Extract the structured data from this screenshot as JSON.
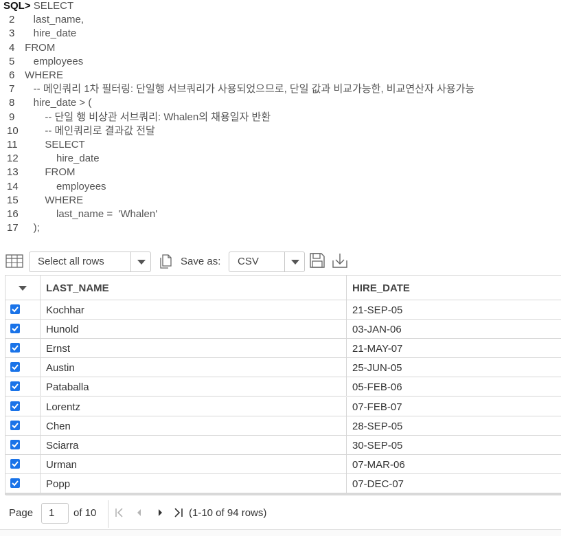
{
  "editor": {
    "prompt": "SQL>",
    "lines": [
      {
        "num": "",
        "text": " SELECT"
      },
      {
        "num": "2",
        "text": "    last_name,"
      },
      {
        "num": "3",
        "text": "    hire_date"
      },
      {
        "num": "4",
        "text": " FROM"
      },
      {
        "num": "5",
        "text": "    employees"
      },
      {
        "num": "6",
        "text": " WHERE"
      },
      {
        "num": "7",
        "text": "    -- 메인쿼리 1차 필터링: 단일행 서브쿼리가 사용되었으므로, 단일 값과 비교가능한, 비교연산자 사용가능"
      },
      {
        "num": "8",
        "text": "    hire_date > ("
      },
      {
        "num": "9",
        "text": "        -- 단일 행 비상관 서브쿼리: Whalen의 채용일자 반환"
      },
      {
        "num": "10",
        "text": "        -- 메인쿼리로 결과값 전달"
      },
      {
        "num": "11",
        "text": "        SELECT"
      },
      {
        "num": "12",
        "text": "            hire_date"
      },
      {
        "num": "13",
        "text": "        FROM"
      },
      {
        "num": "14",
        "text": "            employees"
      },
      {
        "num": "15",
        "text": "        WHERE"
      },
      {
        "num": "16",
        "text": "            last_name =  'Whalen'"
      },
      {
        "num": "17",
        "text": "    );"
      }
    ]
  },
  "toolbar": {
    "grid_icon": "table-grid-icon",
    "row_select": "Select all rows",
    "copy_icon": "copy-icon",
    "save_as_label": "Save as:",
    "format_select": "CSV",
    "save_icon": "floppy-disk-icon",
    "download_icon": "download-icon"
  },
  "grid": {
    "columns": [
      "LAST_NAME",
      "HIRE_DATE"
    ],
    "rows": [
      {
        "last_name": "Kochhar",
        "hire_date": "21-SEP-05",
        "checked": true
      },
      {
        "last_name": "Hunold",
        "hire_date": "03-JAN-06",
        "checked": true
      },
      {
        "last_name": "Ernst",
        "hire_date": "21-MAY-07",
        "checked": true
      },
      {
        "last_name": "Austin",
        "hire_date": "25-JUN-05",
        "checked": true
      },
      {
        "last_name": "Pataballa",
        "hire_date": "05-FEB-06",
        "checked": true
      },
      {
        "last_name": "Lorentz",
        "hire_date": "07-FEB-07",
        "checked": true
      },
      {
        "last_name": "Chen",
        "hire_date": "28-SEP-05",
        "checked": true
      },
      {
        "last_name": "Sciarra",
        "hire_date": "30-SEP-05",
        "checked": true
      },
      {
        "last_name": "Urman",
        "hire_date": "07-MAR-06",
        "checked": true
      },
      {
        "last_name": "Popp",
        "hire_date": "07-DEC-07",
        "checked": true
      }
    ],
    "checkbox_color": "#1a73e8"
  },
  "pager": {
    "page_label": "Page",
    "page_value": "1",
    "of_label": "of 10",
    "summary": "(1-10 of 94 rows)"
  }
}
